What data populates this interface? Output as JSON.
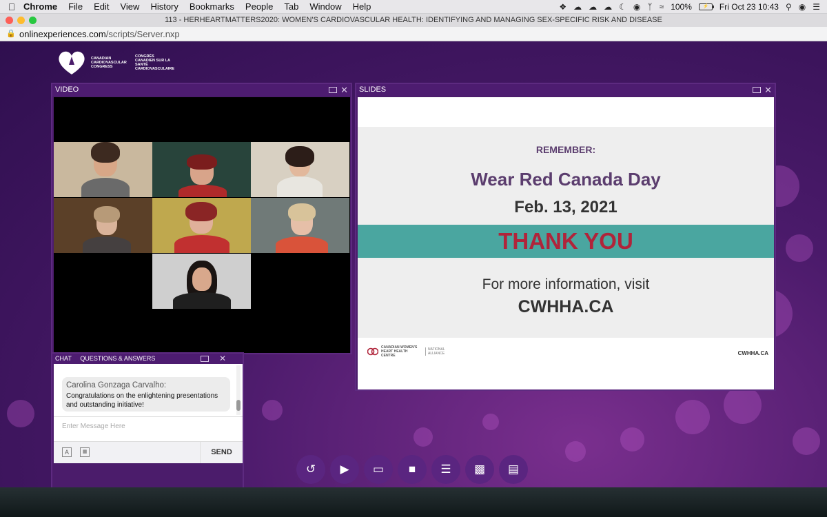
{
  "menubar": {
    "app": "Chrome",
    "items": [
      "File",
      "Edit",
      "View",
      "History",
      "Bookmarks",
      "People",
      "Tab",
      "Window",
      "Help"
    ],
    "battery": "100%",
    "clock": "Fri Oct 23  10:43"
  },
  "window": {
    "title": "113 - HERHEARTMATTERS2020: WOMEN'S CARDIOVASCULAR HEALTH: IDENTIFYING AND MANAGING SEX-SPECIFIC RISK AND DISEASE",
    "url_host": "onlinexperiences.com",
    "url_path": "/scripts/Server.nxp"
  },
  "logo": {
    "en": "CANADIAN CARDIOVASCULAR CONGRESS",
    "fr": "CONGRÈS CANADIEN SUR LA SANTÉ CARDIOVASCULAIRE"
  },
  "video": {
    "header": "VIDEO"
  },
  "slides": {
    "header": "SLIDES",
    "remember": "REMEMBER:",
    "event": "Wear Red Canada Day",
    "date": "Feb. 13, 2021",
    "thanks": "THANK YOU",
    "more": "For more information, visit",
    "site": "CWHHA.CA",
    "footer_logo": "CANADIAN WOMEN'S HEART HEALTH CENTRE",
    "footer_logo_2": "NATIONAL ALLIANCE",
    "footer_site": "CWHHA.CA"
  },
  "chat": {
    "tabs": [
      "CHAT",
      "QUESTIONS & ANSWERS"
    ],
    "message_author": "Carolina Gonzaga Carvalho:",
    "message_text": "Congratulations on the enlightening presentations and outstanding initiative!",
    "placeholder": "Enter Message Here",
    "send": "SEND"
  },
  "toolbar": {
    "buttons": [
      "refresh-icon",
      "video-icon",
      "slides-icon",
      "chat-icon",
      "agenda-icon",
      "qa-icon",
      "documents-icon"
    ]
  },
  "colors": {
    "purple": "#4b1c6b",
    "teal": "#4aa6a0",
    "thanks_red": "#b0243a",
    "slide_heading": "#5b3d6e"
  }
}
